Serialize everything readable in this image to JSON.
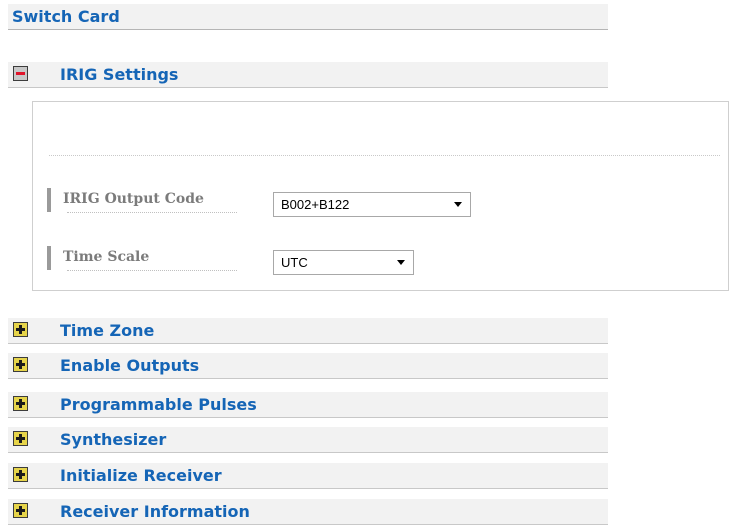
{
  "card_title": "Switch Card",
  "irig": {
    "title": "IRIG Settings",
    "output_code_label": "IRIG Output Code",
    "output_code_value": "B002+B122",
    "time_scale_label": "Time Scale",
    "time_scale_value": "UTC"
  },
  "sections": [
    {
      "label": "Time Zone"
    },
    {
      "label": "Enable Outputs"
    },
    {
      "label": "Programmable Pulses"
    },
    {
      "label": "Synthesizer"
    },
    {
      "label": "Initialize Receiver"
    },
    {
      "label": "Receiver Information"
    }
  ],
  "colors": {
    "accent": "#1565b6",
    "collapse_icon": "#e0142a",
    "expand_icon": "#e6d44a"
  }
}
